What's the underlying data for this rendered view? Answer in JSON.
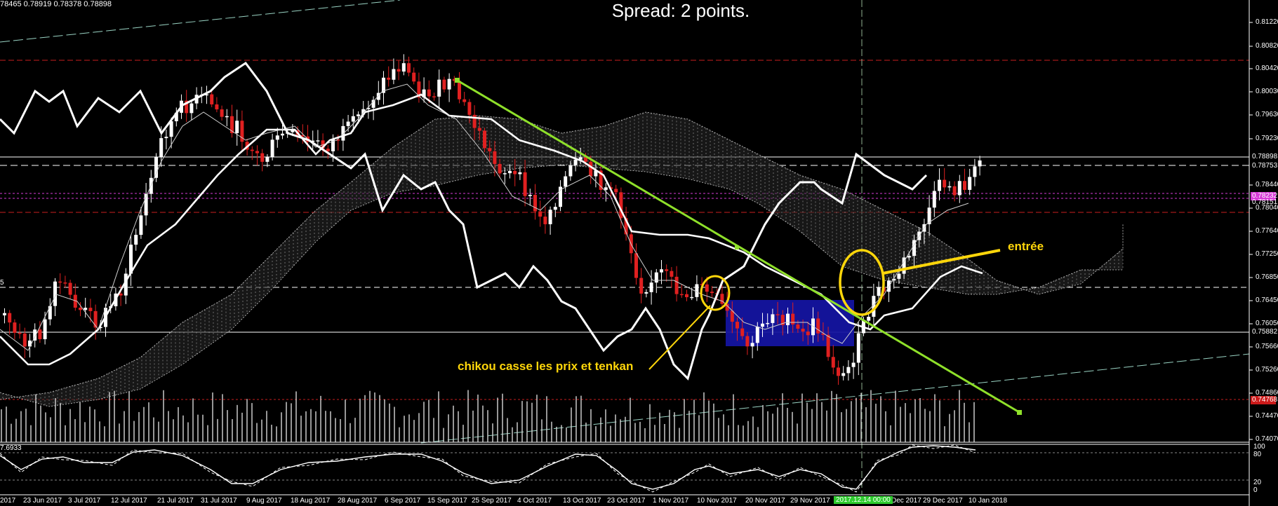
{
  "header": {
    "ohlc": "78465 0.78919 0.78378 0.78898",
    "spread": "Spread: 2 points."
  },
  "left_marker": "5",
  "oscillator_label": "7.6933",
  "price_axis": [
    "0.81220",
    "0.80820",
    "0.80420",
    "0.80030",
    "0.79630",
    "0.79230",
    "0.78440",
    "0.78040",
    "0.77640",
    "0.77250",
    "0.76850",
    "0.76450",
    "0.76050",
    "0.75660",
    "0.75260",
    "0.74860",
    "0.74470",
    "0.74070"
  ],
  "price_tags": [
    {
      "label": "0.78898",
      "bg": "#000000"
    },
    {
      "label": "0.78753",
      "bg": "#000000"
    },
    {
      "label": "0.78232",
      "bg": "#d63ad6"
    },
    {
      "label": "0.78151",
      "bg": "#000000"
    },
    {
      "label": "0.75882",
      "bg": "#000000"
    },
    {
      "label": "0.74768",
      "bg": "#cc1a1a"
    }
  ],
  "oscillator_axis": [
    "100",
    "80",
    "20",
    "0"
  ],
  "date_axis": [
    "2017",
    "23 Jun 2017",
    "3 Jul 2017",
    "12 Jul 2017",
    "21 Jul 2017",
    "31 Jul 2017",
    "9 Aug 2017",
    "18 Aug 2017",
    "28 Aug 2017",
    "6 Sep 2017",
    "15 Sep 2017",
    "25 Sep 2017",
    "4 Oct 2017",
    "13 Oct 2017",
    "23 Oct 2017",
    "1 Nov 2017",
    "10 Nov 2017",
    "20 Nov 2017",
    "29 Nov 2017",
    "Dec 2017",
    "29 Dec 2017",
    "10 Jan 2018"
  ],
  "date_highlight": "2017.12.14 00:00",
  "annotations": {
    "chikou": "chikou casse les prix et tenkan",
    "entry": "entrée"
  },
  "colors": {
    "background": "#000000",
    "bull_candle": "#ffffff",
    "bear_candle": "#e02020",
    "trendline": "#8fe02a",
    "annotation": "#ffd60a",
    "consolidation_box": "#1414a0",
    "kumo": "#bfbfbf"
  }
}
